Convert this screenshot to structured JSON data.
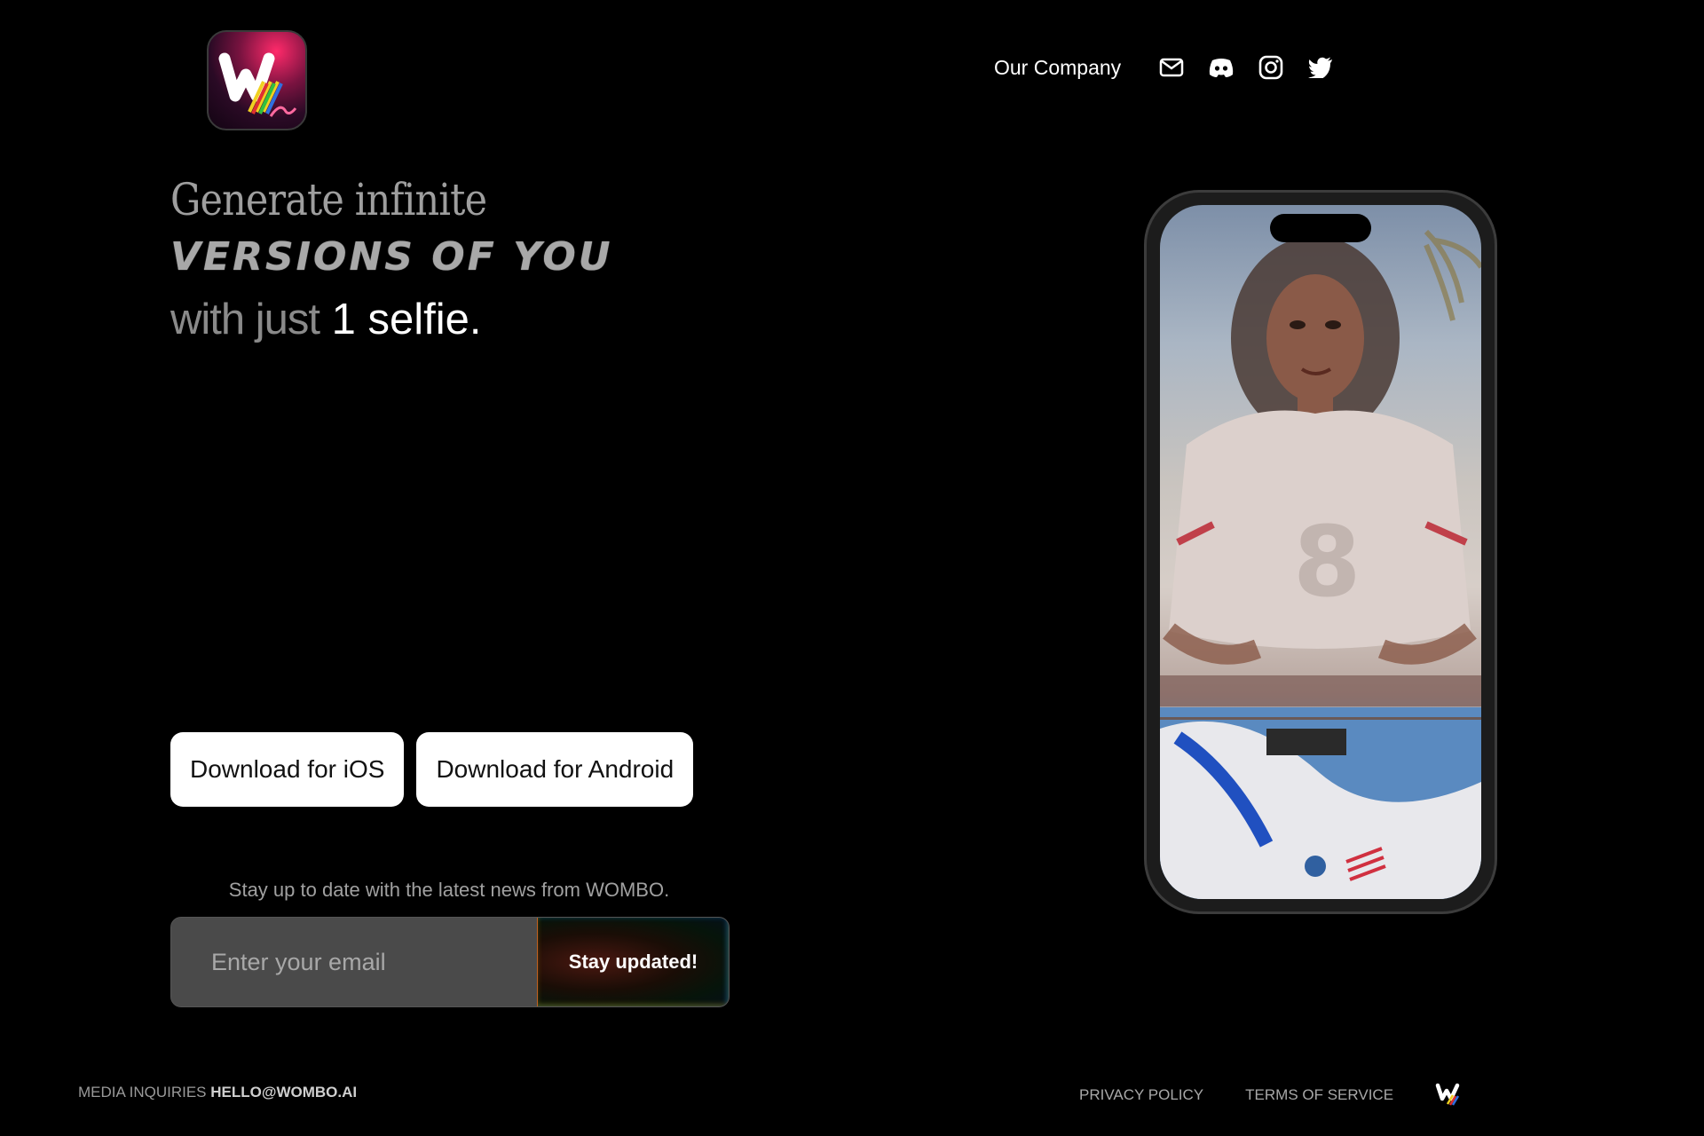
{
  "brand": {
    "app_icon": "wombo-me-app-icon",
    "footer_logo": "wombo-w-logo"
  },
  "nav": {
    "company_label": "Our Company",
    "icons": [
      "mail-icon",
      "discord-icon",
      "instagram-icon",
      "twitter-icon"
    ]
  },
  "hero": {
    "line1": "Generate infinite",
    "line2": "VERSIONS OF YOU",
    "line3_muted": "with just",
    "line3_strong": "1 selfie."
  },
  "downloads": {
    "ios_label": "Download for iOS",
    "android_label": "Download for Android"
  },
  "newsletter": {
    "text": "Stay up to date with the latest news from WOMBO.",
    "placeholder": "Enter your email",
    "submit_label": "Stay updated!"
  },
  "footer": {
    "media_prefix": "MEDIA INQUIRIES",
    "media_email": "HELLO@WOMBO.AI",
    "privacy": "PRIVACY POLICY",
    "terms": "TERMS OF SERVICE"
  },
  "colors": {
    "background": "#000000",
    "button_bg": "#ffffff",
    "input_bg": "#4a4a4a"
  }
}
